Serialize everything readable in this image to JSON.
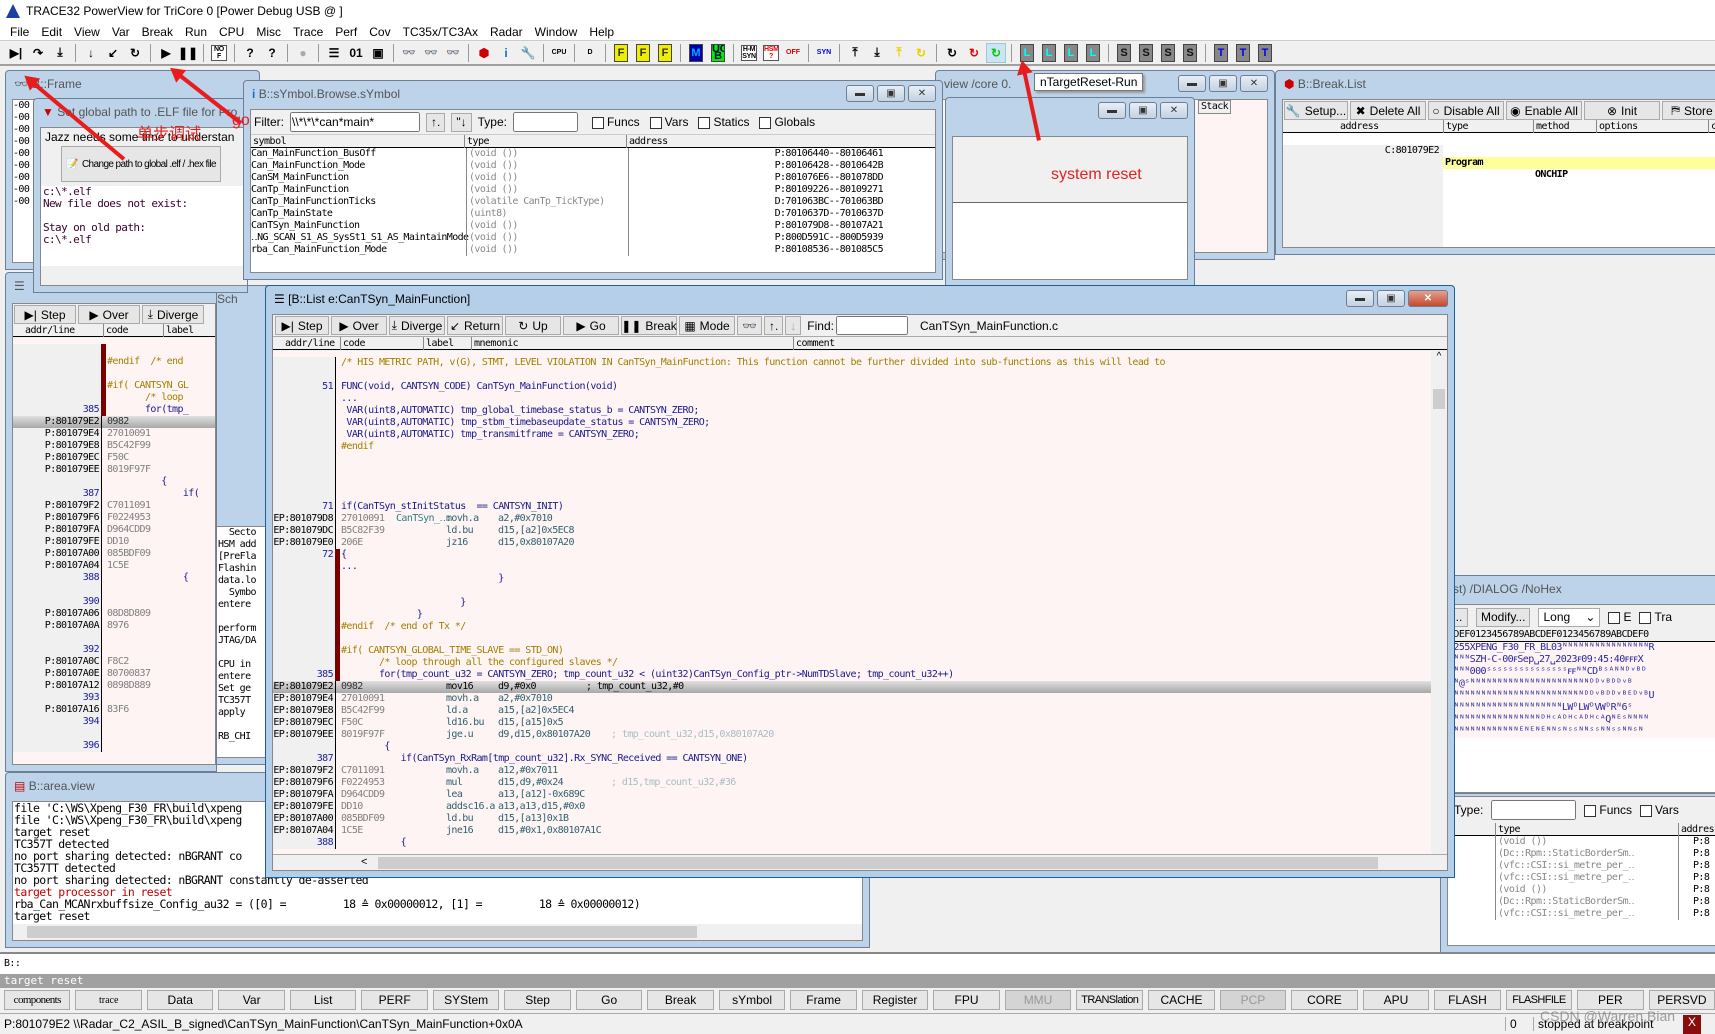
{
  "app": {
    "title": "TRACE32 PowerView for TriCore 0 [Power Debug USB @ ]"
  },
  "menu": [
    "File",
    "Edit",
    "View",
    "Var",
    "Break",
    "Run",
    "CPU",
    "Misc",
    "Trace",
    "Perf",
    "Cov",
    "TC35x/TC3Ax",
    "Radar",
    "Window",
    "Help"
  ],
  "toolbar": {
    "tooltip": "nTargetReset-Run",
    "icons": [
      "step-icon",
      "over-icon",
      "diverge-icon",
      "step-down-icon",
      "return-icon",
      "up-icon",
      "go-icon",
      "break-icon",
      "mode-icon",
      "help-icon",
      "context-help-icon",
      "stop-icon",
      "list-icon",
      "memory-icon",
      "chip-icon",
      "var-watch-icon",
      "var-view-icon",
      "var-frame-icon",
      "breakpoint-icon",
      "info-icon",
      "wrench-icon",
      "cpu-icon",
      "data-icon",
      "flash-icon",
      "flash1-icon",
      "flash2-icon",
      "m-icon",
      "ucb-icon",
      "hm-syn-icon",
      "hsm-icon",
      "hsm-off-icon",
      "syn-icon",
      "go-up-icon",
      "go-down-icon",
      "yellow-up-icon",
      "yellow-return-icon",
      "reset-icon",
      "reset-red-icon",
      "reset-run-icon",
      "l1-icon",
      "l2-icon",
      "l3-icon",
      "l4-icon",
      "s1-icon",
      "s2-icon",
      "s3-icon",
      "s4-icon",
      "t1-icon",
      "t2-icon",
      "t3-icon"
    ],
    "labels": {
      "M": "M",
      "UCB": "UC B",
      "HMSYN": "H-M SYN",
      "HSM": "HSM ?",
      "HSMOFF": "HSM OFF",
      "SYN": "SYN",
      "CPU": "CPU",
      "F": "F",
      "L": "L",
      "S": "S",
      "T": "T",
      "STOP": "STOP",
      "NOF": "NO F"
    }
  },
  "annotations": {
    "step_debug": "单步调试",
    "go": "go",
    "system_reset": "system reset"
  },
  "frame_window": {
    "title": "B::Frame",
    "lines": [
      "-00",
      "-00",
      "-00",
      "-00",
      "-00",
      "-00",
      "-00",
      "-00",
      "",
      "-00"
    ]
  },
  "path_dialog": {
    "title": "Set global path to .ELF file for Pro",
    "message": "Jazz needs some time to understan",
    "button": "Change path to global .elf / .hex file",
    "lines": [
      "c:\\*.elf",
      "New file does not exist:",
      "",
      "Stay on old path:",
      "c:\\*.elf"
    ]
  },
  "symbol_window": {
    "title": "B::sYmbol.Browse.sYmbol",
    "filter_label": "Filter:",
    "filter_value": "\\\\*\\*\\*can*main*",
    "type_label": "Type:",
    "type_value": "",
    "checks": [
      "Funcs",
      "Vars",
      "Statics",
      "Globals"
    ],
    "columns": [
      "symbol",
      "type",
      "address"
    ],
    "rows": [
      [
        "Can_MainFunction_BusOff",
        "(void ())",
        "P:80106440--80106461"
      ],
      [
        "Can_MainFunction_Mode",
        "(void ())",
        "P:80106428--8010642B"
      ],
      [
        "CanSM_MainFunction",
        "(void ())",
        "P:801076E6--801078DD"
      ],
      [
        "CanTp_MainFunction",
        "(void ())",
        "P:80109226--80109271"
      ],
      [
        "CanTp_MainFunctionTicks",
        "(volatile CanTp_TickType)",
        "D:701063BC--701063BD"
      ],
      [
        "CanTp_MainState",
        "(uint8)",
        "D:7010637D--7010637D"
      ],
      [
        "CanTSyn_MainFunction",
        "(void ())",
        "P:801079D8--80107A21"
      ],
      [
        "‥NG_SCAN_S1_AS_SysSt1_S1_AS_MaintainMode",
        "(void ())",
        "P:800D591C--800D5939"
      ],
      [
        "rba_Can_MainFunction_Mode",
        "(void ())",
        "P:80108536--801085C5"
      ]
    ]
  },
  "bg_windows": {
    "view_core": "view /core 0.",
    "stack": "Stack",
    "sch": "Sch",
    "hexdump_title": "st) /DIALOG /NoHex"
  },
  "break_window": {
    "title": "B::Break.List",
    "buttons": [
      "Setup...",
      "Delete All",
      "Disable All",
      "Enable All",
      "Init",
      "Store"
    ],
    "columns": [
      "address",
      "type",
      "method",
      "options",
      "c"
    ],
    "rows": [
      [
        "C:801079E2",
        "Program",
        "ONCHIP",
        ""
      ]
    ]
  },
  "list_window": {
    "title": "[B::List e:CanTSyn_MainFunction]",
    "buttons": [
      "Step",
      "Over",
      "Diverge",
      "Return",
      "Up",
      "Go",
      "Break",
      "Mode"
    ],
    "find_label": "Find:",
    "find_value": "",
    "file": "CanTSyn_MainFunction.c",
    "columns": [
      "addr/line",
      "code",
      "label",
      "mnemonic",
      "comment"
    ],
    "rows": [
      {
        "k": "pre",
        "src": "/* HIS METRIC PATH, v(G), STMT, LEVEL VIOLATION IN CanTSyn_MainFunction: This function cannot be further divided into sub-functions as this will lead to"
      },
      {
        "k": "blank"
      },
      {
        "k": "src",
        "line": "51",
        "src": "FUNC(void, CANTSYN_CODE) CanTSyn_MainFunction(void)"
      },
      {
        "k": "src",
        "src": "..."
      },
      {
        "k": "src",
        "src": " VAR(uint8,AUTOMATIC) tmp_global_timebase_status_b = CANTSYN_ZERO;"
      },
      {
        "k": "src",
        "src": " VAR(uint8,AUTOMATIC) tmp_stbm_timebaseupdate_status = CANTSYN_ZERO;"
      },
      {
        "k": "src",
        "src": " VAR(uint8,AUTOMATIC) tmp_transmitframe = CANTSYN_ZERO;"
      },
      {
        "k": "pre",
        "src": "#endif"
      },
      {
        "k": "blank"
      },
      {
        "k": "blank"
      },
      {
        "k": "blank"
      },
      {
        "k": "blank"
      },
      {
        "k": "src",
        "line": "71",
        "src": "if(CanTSyn_stInitStatus  == CANTSYN_INIT)"
      },
      {
        "k": "asm",
        "addr": "EP:801079D8",
        "hex": "27010091",
        "label": "CanTSyn_‥:",
        "mn": "movh.a",
        "op": "a2,#0x7010"
      },
      {
        "k": "asm",
        "addr": "EP:801079DC",
        "hex": "B5C82F39",
        "mn": "ld.bu",
        "op": "d15,[a2]0x5EC8"
      },
      {
        "k": "asm",
        "addr": "EP:801079E0",
        "hex": "206E",
        "mn": "jz16",
        "op": "d15,0x80107A20"
      },
      {
        "k": "src",
        "line": "72",
        "src": "{",
        "mark": true
      },
      {
        "k": "src",
        "src": "...",
        "mark": true
      },
      {
        "k": "src",
        "src": "                             }",
        "mark": true
      },
      {
        "k": "blank",
        "mark": true
      },
      {
        "k": "src",
        "src": "                      }",
        "mark": true
      },
      {
        "k": "src",
        "src": "              }",
        "mark": true
      },
      {
        "k": "pre",
        "src": "#endif  /* end of Tx */",
        "mark": true
      },
      {
        "k": "blank",
        "mark": true
      },
      {
        "k": "pre",
        "src": "#if( CANTSYN_GLOBAL_TIME_SLAVE == STD_ON)",
        "mark": true
      },
      {
        "k": "pre",
        "src": "       /* loop through all the configured slaves */",
        "mark": true
      },
      {
        "k": "src",
        "line": "385",
        "src": "       for(tmp_count_u32 = CANTSYN_ZERO; tmp_count_u32 < (uint32)CanTSyn_Config_ptr->NumTDSlave; tmp_count_u32++)",
        "mark": true
      },
      {
        "k": "asm",
        "cur": true,
        "addr": "EP:801079E2",
        "hex": "0982",
        "mn": "mov16",
        "op": "d9,#0x0",
        "cmt": "; tmp_count_u32,#0"
      },
      {
        "k": "asm",
        "addr": "EP:801079E4",
        "hex": "27010091",
        "mn": "movh.a",
        "op": "a2,#0x7010"
      },
      {
        "k": "asm",
        "addr": "EP:801079E8",
        "hex": "B5C42F99",
        "mn": "ld.a",
        "op": "a15,[a2]0x5EC4"
      },
      {
        "k": "asm",
        "addr": "EP:801079EC",
        "hex": "F50C",
        "mn": "ld16.bu",
        "op": "d15,[a15]0x5"
      },
      {
        "k": "asm",
        "addr": "EP:801079EE",
        "hex": "8019F97F",
        "mn": "jge.u",
        "op": "d9,d15,0x80107A20",
        "cmt": "; tmp_count_u32,d15,0x80107A20"
      },
      {
        "k": "src",
        "src": "        {"
      },
      {
        "k": "src",
        "line": "387",
        "src": "           if(CanTSyn_RxRam[tmp_count_u32].Rx_SYNC_Received == CANTSYN_ONE)"
      },
      {
        "k": "asm",
        "addr": "EP:801079F2",
        "hex": "C7011091",
        "mn": "movh.a",
        "op": "a12,#0x7011"
      },
      {
        "k": "asm",
        "addr": "EP:801079F6",
        "hex": "F0224953",
        "mn": "mul",
        "op": "d15,d9,#0x24",
        "cmt": "; d15,tmp_count_u32,#36"
      },
      {
        "k": "asm",
        "addr": "EP:801079FA",
        "hex": "D964CDD9",
        "mn": "lea",
        "op": "a13,[a12]-0x689C"
      },
      {
        "k": "asm",
        "addr": "EP:801079FE",
        "hex": "DD10",
        "mn": "addsc16.a",
        "op": "a13,a13,d15,#0x0"
      },
      {
        "k": "asm",
        "addr": "EP:80107A00",
        "hex": "085BDF09",
        "mn": "ld.bu",
        "op": "d15,[a13]0x1B"
      },
      {
        "k": "asm",
        "addr": "EP:80107A04",
        "hex": "1C5E",
        "mn": "jne16",
        "op": "d15,#0x1,0x80107A1C"
      },
      {
        "k": "src",
        "line": "388",
        "src": "           {"
      }
    ]
  },
  "left_list": {
    "buttons": [
      "Step",
      "Over",
      "Diverge"
    ],
    "columns": [
      "addr/line",
      "code",
      "label"
    ],
    "rows": [
      {
        "k": "blank",
        "mark": true
      },
      {
        "k": "pre",
        "src": "#endif  /* end",
        "mark": true
      },
      {
        "k": "blank",
        "mark": true
      },
      {
        "k": "pre",
        "src": "#if( CANTSYN_GL",
        "mark": true
      },
      {
        "k": "pre",
        "src": "       /* loop",
        "mark": true
      },
      {
        "k": "src",
        "line": "385",
        "src": "       for(tmp_",
        "mark": true
      },
      {
        "k": "asm",
        "cur": true,
        "addr": "P:801079E2",
        "hex": "0982"
      },
      {
        "k": "asm",
        "addr": "P:801079E4",
        "hex": "27010091"
      },
      {
        "k": "asm",
        "addr": "P:801079E8",
        "hex": "B5C42F99"
      },
      {
        "k": "asm",
        "addr": "P:801079EC",
        "hex": "F50C"
      },
      {
        "k": "asm",
        "addr": "P:801079EE",
        "hex": "8019F97F"
      },
      {
        "k": "src",
        "src": "          {"
      },
      {
        "k": "src",
        "line": "387",
        "src": "              if("
      },
      {
        "k": "asm",
        "addr": "P:801079F2",
        "hex": "C7011091"
      },
      {
        "k": "asm",
        "addr": "P:801079F6",
        "hex": "F0224953"
      },
      {
        "k": "asm",
        "addr": "P:801079FA",
        "hex": "D964CDD9"
      },
      {
        "k": "asm",
        "addr": "P:801079FE",
        "hex": "DD10"
      },
      {
        "k": "asm",
        "addr": "P:80107A00",
        "hex": "085BDF09"
      },
      {
        "k": "asm",
        "addr": "P:80107A04",
        "hex": "1C5E"
      },
      {
        "k": "src",
        "line": "388",
        "src": "              {"
      },
      {
        "k": "blank"
      },
      {
        "k": "src",
        "line": "390",
        "src": ""
      },
      {
        "k": "asm",
        "addr": "P:80107A06",
        "hex": "08D8D809"
      },
      {
        "k": "asm",
        "addr": "P:80107A0A",
        "hex": "8976"
      },
      {
        "k": "blank"
      },
      {
        "k": "src",
        "line": "392",
        "src": ""
      },
      {
        "k": "asm",
        "addr": "P:80107A0C",
        "hex": "F8C2"
      },
      {
        "k": "asm",
        "addr": "P:80107A0E",
        "hex": "80700837"
      },
      {
        "k": "asm",
        "addr": "P:80107A12",
        "hex": "0898D889"
      },
      {
        "k": "src",
        "line": "393",
        "src": ""
      },
      {
        "k": "asm",
        "addr": "P:80107A16",
        "hex": "83F6"
      },
      {
        "k": "src",
        "line": "394",
        "src": ""
      },
      {
        "k": "blank"
      },
      {
        "k": "src",
        "line": "396",
        "src": ""
      }
    ]
  },
  "message_window": {
    "lines": [
      "  Secto",
      "HSM add",
      "[PreFla",
      "Flashin",
      "data.lo",
      "  Symbo",
      "entere",
      "",
      "perform",
      "JTAG/DA",
      "",
      "CPU in",
      "entere",
      "Set ge",
      "TC357T",
      "apply",
      "",
      "RB_CHI"
    ]
  },
  "area_window": {
    "title": "B::area.view",
    "lines": [
      {
        "t": "file 'C:\\WS\\Xpeng_F30_FR\\build\\xpeng"
      },
      {
        "t": "file 'C:\\WS\\Xpeng_F30_FR\\build\\xpeng"
      },
      {
        "t": "target reset"
      },
      {
        "t": "TC357T detected"
      },
      {
        "t": "no port sharing detected: nBGRANT co"
      },
      {
        "t": "TC357TT detected"
      },
      {
        "t": "no port sharing detected: nBGRANT constantly de-asserted"
      },
      {
        "t": "target processor in reset",
        "red": true
      },
      {
        "t": "rba_Can_MCANrxbuffsize_Config_au32 = ([0] =         18 ≙ 0x00000012, [1] =         18 ≙ 0x00000012)"
      },
      {
        "t": "target reset"
      }
    ]
  },
  "hex_window": {
    "modify": "Modify...",
    "format": "Long",
    "checks": [
      "E",
      "Tra"
    ],
    "header": "CDEF0123456789ABCDEF0123456789ABCDEF0",
    "rows": [
      "f255XPENG_F30_FR_BL03ᴺᴺᴺᴺᴺᴺᴺᴺᴺᴺᴺᴺᴺᴺᴺᴺR",
      "ᴺᴺᴺᴺSZH-C-00ꜰSep␣27␣2023ꜰ09:45:40ꜰꜰꜰX",
      "ᴺᴺᴺᴺ000ˢˢˢˢˢˢˢˢˢˢˢˢˢˢˢꜰꜰᴺᴺCDᴮˢᴬᴺᴺᴰᵛᴮᴰ",
      "Pᴺ@ˢᴺᴺᴺᴺᴺᴺᴺᴺᴺᴺᴺᴺᴺᴺᴺᴺᴺᴺᴺᴺᴺᴺᴰᴰᵛᴮᴰᴰᵛᴮ",
      "ᴺᴺᴺᴺᴺᴺᴺᴺᴺᴺᴺᴺᴺᴺᴺᴺᴺᴺᴺᴺᴺᴺᴺᴺᴺᴰᴰᵛᴮᴰᴰᵛᴮᴱᴰᵛᴮU",
      "ᴺᴺᴺᴺᴺᴺᴺᴺᴺᴺᴺᴺᴺᴺᴺᴺᴺᴺᴺᴺᴺLWᴰLWᴰVWᴰRᴺ6ˢ",
      "ᴺᴺᴺᴺᴺᴺᴺᴺᴺᴺᴺᴺᴺᴺᴺᴺᴺᴰᴴᶜᴬᴰᴴᶜᴬᴰᴴᶜᴬQᴺᴱˢᴺᴺᴺᴺ",
      "ᴺᴺᴺᴺᴺᴺᴺᴺᴺᴺᴺᴺᴺᴱᴺᴱᴺᴱᴺᴺˢᴺˢˢᴺᴺˢˢᴺᴺˢˢᴺᴺˢᴺ"
    ]
  },
  "symbol_window2": {
    "type_label": "Type:",
    "checks": [
      "Funcs",
      "Vars"
    ],
    "columns": [
      "type",
      "addres"
    ],
    "rows": [
      [
        "(void ())",
        "P:8"
      ],
      [
        "(Dc::Rpm::StaticBorderSm‥",
        "P:8"
      ],
      [
        "(vfc::CSI::si_metre_per_‥",
        "P:8"
      ],
      [
        "(vfc::CSI::si_metre_per_‥",
        "P:8"
      ],
      [
        "(void ())",
        "P:8"
      ],
      [
        "(Dc::Rpm::StaticBorderSm‥",
        "P:8"
      ],
      [
        "(vfc::CSI::si_metre_per_‥",
        "P:8"
      ]
    ]
  },
  "command": {
    "prompt": "B::",
    "value": "",
    "last_message": "target reset"
  },
  "softkeys": [
    {
      "l": "components",
      "small": true
    },
    {
      "l": "trace",
      "small": true
    },
    {
      "l": "Data"
    },
    {
      "l": "Var"
    },
    {
      "l": "List"
    },
    {
      "l": "PERF"
    },
    {
      "l": "SYStem"
    },
    {
      "l": "Step"
    },
    {
      "l": "Go"
    },
    {
      "l": "Break"
    },
    {
      "l": "sYmbol"
    },
    {
      "l": "Frame"
    },
    {
      "l": "Register"
    },
    {
      "l": "FPU"
    },
    {
      "l": "MMU",
      "disabled": true
    },
    {
      "l": "TRANSlation"
    },
    {
      "l": "CACHE"
    },
    {
      "l": "PCP",
      "disabled": true
    },
    {
      "l": "CORE"
    },
    {
      "l": "APU"
    },
    {
      "l": "FLASH"
    },
    {
      "l": "FLASHFILE"
    },
    {
      "l": "PER"
    },
    {
      "l": "PERSVD"
    }
  ],
  "status": {
    "location": "P:801079E2  \\\\Radar_C2_ASIL_B_signed\\CanTSyn_MainFunction\\CanTSyn_MainFunction+0x0A",
    "count": "0",
    "state": "stopped at breakpoint",
    "indicator": "X",
    "watermark": "CSDN @Warren.Bian"
  },
  "colors": {
    "accent_red": "#e81c1c",
    "listing_bg": "#fff4f4",
    "current_row": "#b0b0b0",
    "breakpoint_row": "#ffff99"
  }
}
